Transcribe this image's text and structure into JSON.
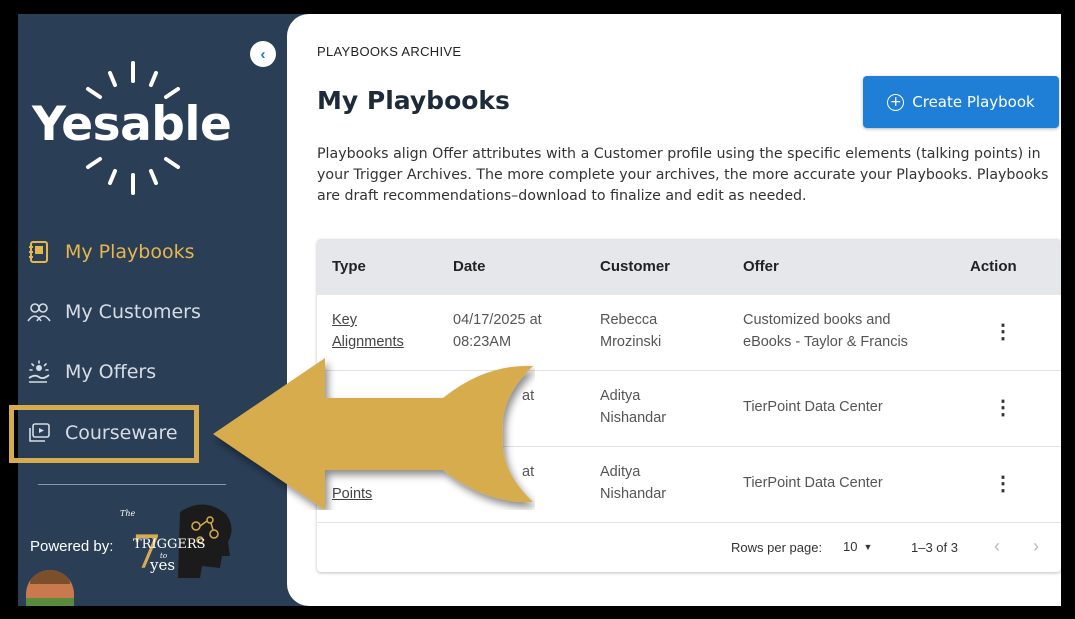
{
  "sidebar": {
    "logo_text": "Yesable",
    "items": [
      {
        "label": "My Playbooks",
        "icon": "playbook-icon",
        "active": true
      },
      {
        "label": "My Customers",
        "icon": "customers-icon",
        "active": false
      },
      {
        "label": "My Offers",
        "icon": "offers-icon",
        "active": false
      },
      {
        "label": "Courseware",
        "icon": "courseware-icon",
        "active": false
      }
    ],
    "powered_by": "Powered by:",
    "partner_logo": {
      "line1": "The",
      "number": "7",
      "line2": "TRIGGERS",
      "line3": "to",
      "line4": "yes"
    }
  },
  "header": {
    "breadcrumb": "PLAYBOOKS ARCHIVE",
    "title": "My Playbooks",
    "create_button": "Create Playbook",
    "description": "Playbooks align Offer attributes with a Customer profile using the specific elements (talking points) in your Trigger Archives. The more complete your archives, the more accurate your Playbooks. Playbooks are draft recommendations–download to finalize and edit as needed."
  },
  "table": {
    "columns": [
      "Type",
      "Date",
      "Customer",
      "Offer",
      "Action"
    ],
    "rows": [
      {
        "type_line1": "Key",
        "type_line2": "Alignments",
        "date_line1": "04/17/2025 at",
        "date_line2": "08:23AM",
        "customer_line1": "Rebecca",
        "customer_line2": "Mrozinski",
        "offer_line1": "Customized books and",
        "offer_line2": "eBooks - Taylor & Francis"
      },
      {
        "type_line1": "",
        "type_line2": "",
        "date_line1": "at",
        "date_line2": "",
        "customer_line1": "Aditya",
        "customer_line2": "Nishandar",
        "offer_line1": "TierPoint Data Center",
        "offer_line2": ""
      },
      {
        "type_line1": "",
        "type_line2": "Points",
        "date_line1": "at",
        "date_line2": "",
        "customer_line1": "Aditya",
        "customer_line2": "Nishandar",
        "offer_line1": "TierPoint Data Center",
        "offer_line2": ""
      }
    ],
    "footer": {
      "rows_per_page_label": "Rows per page:",
      "rows_per_page_value": "10",
      "range": "1–3 of 3"
    }
  },
  "colors": {
    "sidebar_bg": "#2a3e56",
    "accent_gold": "#e7b64c",
    "arrow_gold": "#d6ac4e",
    "primary_blue": "#1f7fd6"
  }
}
